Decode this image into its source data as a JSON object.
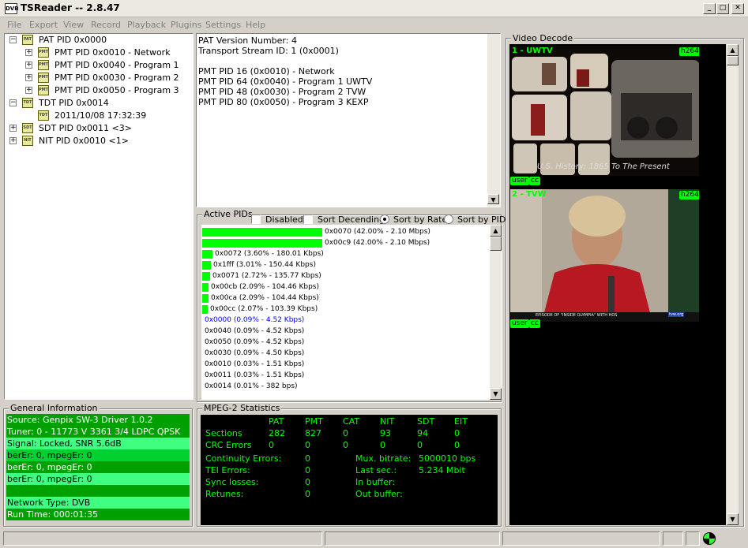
{
  "window": {
    "logo": "DVB",
    "title": "TSReader -- 2.8.47",
    "min": "_",
    "max": "□",
    "close": "✕"
  },
  "menu": [
    "File",
    "Export",
    "View",
    "Record",
    "Playback",
    "Plugins",
    "Settings",
    "Help"
  ],
  "tree": [
    {
      "label": "PAT PID 0x0000",
      "exp": "−",
      "icon": "PAT"
    },
    {
      "label": "PMT PID 0x0010 - Network",
      "exp": "+",
      "icon": "PMT"
    },
    {
      "label": "PMT PID 0x0040 - Program 1",
      "exp": "+",
      "icon": "PMT"
    },
    {
      "label": "PMT PID 0x0030 - Program 2",
      "exp": "+",
      "icon": "PMT"
    },
    {
      "label": "PMT PID 0x0050 - Program 3",
      "exp": "+",
      "icon": "PMT"
    },
    {
      "label": "TDT PID 0x0014",
      "exp": "−",
      "icon": "TDT"
    },
    {
      "label": "2011/10/08 17:32:39",
      "exp": "",
      "icon": "TDT"
    },
    {
      "label": "SDT PID 0x0011 <3>",
      "exp": "+",
      "icon": "SDT"
    },
    {
      "label": "NIT PID 0x0010 <1>",
      "exp": "+",
      "icon": "NIT"
    }
  ],
  "pat_info": [
    "PAT Version Number: 4",
    "Transport Stream ID: 1 (0x0001)",
    "",
    "PMT PID 16 (0x0010) - Network",
    "PMT PID 64 (0x0040) - Program 1 UWTV",
    "PMT PID 48 (0x0030) - Program 2 TVW",
    "PMT PID 80 (0x0050) - Program 3 KEXP"
  ],
  "active_pids": {
    "title": "Active PIDs",
    "options": {
      "disabled": "Disabled",
      "sort_desc": "Sort Decending",
      "sort_rate": "Sort by Rate",
      "sort_pid": "Sort by PID"
    },
    "selected_sort": "Sort by Rate",
    "rows": [
      {
        "label": "0x0070 (42.00% - 2.10 Mbps)",
        "pct": 42.0,
        "color": "#000"
      },
      {
        "label": "0x00c9 (42.00% - 2.10 Mbps)",
        "pct": 42.0,
        "color": "#000"
      },
      {
        "label": "0x0072 (3.60% - 180.01 Kbps)",
        "pct": 3.6,
        "color": "#000"
      },
      {
        "label": "0x1fff (3.01% - 150.44 Kbps)",
        "pct": 3.01,
        "color": "#000"
      },
      {
        "label": "0x0071 (2.72% - 135.77 Kbps)",
        "pct": 2.72,
        "color": "#000"
      },
      {
        "label": "0x00cb (2.09% - 104.46 Kbps)",
        "pct": 2.09,
        "color": "#000"
      },
      {
        "label": "0x00ca (2.09% - 104.44 Kbps)",
        "pct": 2.09,
        "color": "#000"
      },
      {
        "label": "0x00cc (2.07% - 103.39 Kbps)",
        "pct": 2.07,
        "color": "#000"
      },
      {
        "label": "0x0000 (0.09% - 4.52 Kbps)",
        "pct": 0.09,
        "color": "#0000ff"
      },
      {
        "label": "0x0040 (0.09% - 4.52 Kbps)",
        "pct": 0.09,
        "color": "#000"
      },
      {
        "label": "0x0050 (0.09% - 4.52 Kbps)",
        "pct": 0.09,
        "color": "#000"
      },
      {
        "label": "0x0030 (0.09% - 4.50 Kbps)",
        "pct": 0.09,
        "color": "#000"
      },
      {
        "label": "0x0010 (0.03% - 1.51 Kbps)",
        "pct": 0.03,
        "color": "#000"
      },
      {
        "label": "0x0011 (0.03% - 1.51 Kbps)",
        "pct": 0.03,
        "color": "#000"
      },
      {
        "label": "0x0014 (0.01% - 382 bps)",
        "pct": 0.01,
        "color": "#000"
      }
    ]
  },
  "general": {
    "title": "General Information",
    "rows": [
      {
        "text": "Source: Genpix SW-3 Driver 1.0.2",
        "style": "g1"
      },
      {
        "text": "Tuner: 0 - 11773 V 3361 3/4 LDPC QPSK",
        "style": "g1"
      },
      {
        "text": "Signal: Locked, SNR 5.6dB",
        "style": "g3"
      },
      {
        "text": "berEr: 0, mpegEr: 0",
        "style": "g2"
      },
      {
        "text": "berEr: 0, mpegEr: 0",
        "style": "g1"
      },
      {
        "text": "berEr: 0, mpegEr: 0",
        "style": "g3"
      },
      {
        "text": "",
        "style": "g1"
      },
      {
        "text": "Network Type: DVB",
        "style": "g3"
      },
      {
        "text": "Run Time: 000:01:35",
        "style": "g1"
      }
    ]
  },
  "mpeg2": {
    "title": "MPEG-2 Statistics",
    "headers": [
      "PAT",
      "PMT",
      "CAT",
      "NIT",
      "SDT",
      "EIT"
    ],
    "sections_label": "Sections",
    "sections": [
      "282",
      "827",
      "0",
      "93",
      "94",
      "0"
    ],
    "crc_label": "CRC Errors",
    "crc": [
      "0",
      "0",
      "0",
      "0",
      "0",
      "0"
    ],
    "cont_label": "Continuity Errors:",
    "cont": "0",
    "tei_label": "TEI Errors:",
    "tei": "0",
    "sync_label": "Sync losses:",
    "sync": "0",
    "ret_label": "Retunes:",
    "ret": "0",
    "mux_label": "Mux. bitrate:",
    "mux": "5000010 bps",
    "last_label": "Last sec.:",
    "last": "5.234 Mbit",
    "inbuf_label": "In buffer:",
    "outbuf_label": "Out buffer:"
  },
  "video": {
    "title": "Video Decode",
    "streams": [
      {
        "label": "1 - UWTV",
        "codec": "h264",
        "caption": "U.S. History: 1865 To The Present",
        "tags": [
          "user",
          "cc"
        ]
      },
      {
        "label": "2 - TVW",
        "codec": "h264",
        "caption": "EPISODE OF \"INSIDE OLYMPIA\" WITH HOS",
        "watermark": "tvw.org",
        "tags": [
          "user",
          "cc"
        ]
      }
    ]
  }
}
